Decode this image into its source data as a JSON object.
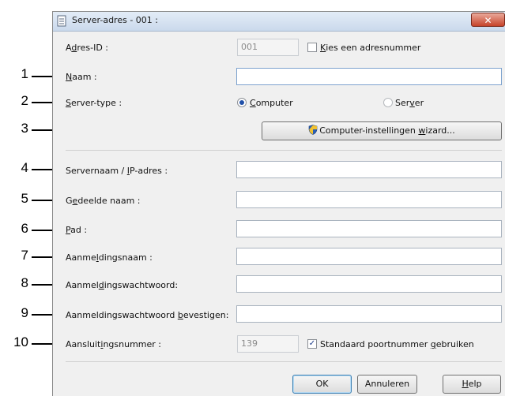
{
  "window": {
    "title": "Server-adres - 001 :",
    "close_glyph": "✕"
  },
  "address_id": {
    "label_pre": "A",
    "label_ul": "d",
    "label_post": "res-ID :",
    "value": "001",
    "checkbox_label_ul": "K",
    "checkbox_label_post": "ies een adresnummer",
    "checked": false
  },
  "name": {
    "label_ul": "N",
    "label_post": "aam :",
    "value": ""
  },
  "server_type": {
    "label_pre": "",
    "label_ul": "S",
    "label_post": "erver-type :",
    "option_computer_ul": "C",
    "option_computer_post": "omputer",
    "option_server_pre": "Ser",
    "option_server_ul": "v",
    "option_server_post": "er",
    "selected": "Computer"
  },
  "wizard_button": {
    "label_pre": "Computer-instellingen ",
    "label_ul": "w",
    "label_post": "izard..."
  },
  "server_name": {
    "label_pre": "Servernaam / ",
    "label_ul": "I",
    "label_post": "P-adres :",
    "value": ""
  },
  "share_name": {
    "label_pre": "G",
    "label_ul": "e",
    "label_post": "deelde naam :",
    "value": ""
  },
  "path": {
    "label_ul": "P",
    "label_post": "ad :",
    "value": ""
  },
  "login_name": {
    "label_pre": "Aanme",
    "label_ul": "l",
    "label_post": "dingsnaam :",
    "value": ""
  },
  "login_password": {
    "label_pre": "Aanmel",
    "label_ul": "d",
    "label_post": "ingswachtwoord:",
    "value": ""
  },
  "confirm_password": {
    "label_pre": "Aanmeldingswachtwoord ",
    "label_ul": "b",
    "label_post": "evestigen:",
    "value": ""
  },
  "port": {
    "label_pre": "Aansluit",
    "label_ul": "i",
    "label_post": "ngsnummer :",
    "value": "139",
    "checkbox_label_pre": "Standaard poortnummer ",
    "checkbox_label_ul": "g",
    "checkbox_label_post": "ebruiken",
    "checked": true,
    "check_glyph": "✓"
  },
  "buttons": {
    "ok": "OK",
    "cancel": "Annuleren",
    "help_ul": "H",
    "help_post": "elp"
  },
  "callouts": [
    "1",
    "2",
    "3",
    "4",
    "5",
    "6",
    "7",
    "8",
    "9",
    "10"
  ],
  "icons": {
    "title": "document-icon",
    "wizard": "shield-icon"
  },
  "colors": {
    "title_bar": "#cad9ec",
    "close": "#c7432a",
    "radio_selected": "#1f4fa8",
    "shield_blue": "#2b5fb3",
    "shield_yellow": "#f2c230"
  }
}
